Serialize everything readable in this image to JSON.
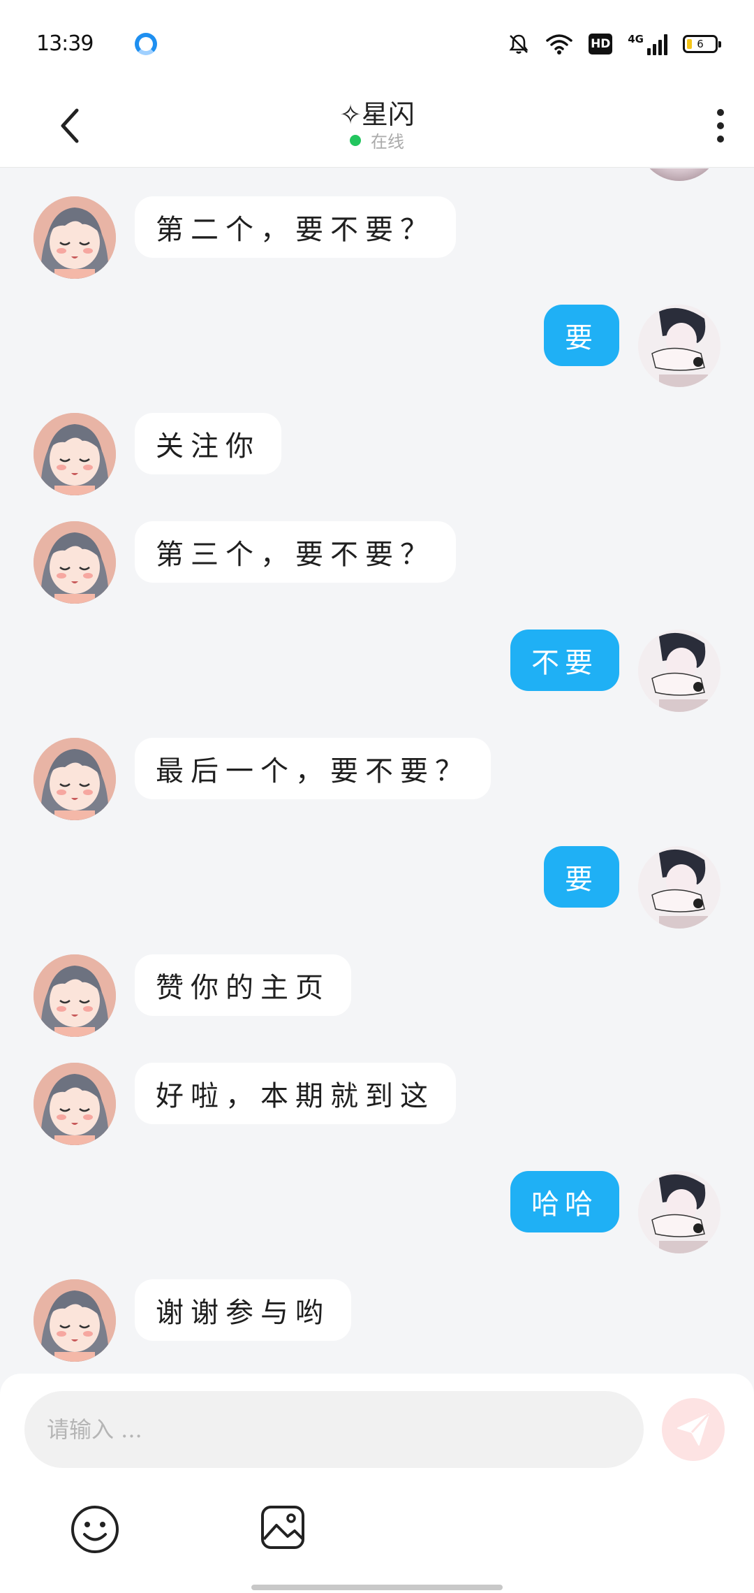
{
  "status_bar": {
    "time": "13:39",
    "network": "4G",
    "hd_label": "HD",
    "battery": "6"
  },
  "header": {
    "back_icon": "chevron-left-icon",
    "title": "✧星闪",
    "online_status": "在线",
    "online_color": "#22c55e",
    "more_icon": "more-vertical-icon"
  },
  "messages": [
    {
      "sender": "other",
      "text": "第二个，要不要？"
    },
    {
      "sender": "me",
      "text": "要"
    },
    {
      "sender": "other",
      "text": "关注你"
    },
    {
      "sender": "other",
      "text": "第三个，要不要？"
    },
    {
      "sender": "me",
      "text": "不要"
    },
    {
      "sender": "other",
      "text": "最后一个，要不要？"
    },
    {
      "sender": "me",
      "text": "要"
    },
    {
      "sender": "other",
      "text": "赞你的主页"
    },
    {
      "sender": "other",
      "text": "好啦，本期就到这"
    },
    {
      "sender": "me",
      "text": "哈哈"
    },
    {
      "sender": "other",
      "text": "谢谢参与哟"
    }
  ],
  "colors": {
    "bubble_me": "#1fb0f5",
    "bubble_other": "#ffffff",
    "background": "#f4f5f7",
    "send_button": "#fde3e3"
  },
  "input": {
    "placeholder": "请输入 ..."
  },
  "toolbar": {
    "emoji_icon": "emoji-icon",
    "image_icon": "image-icon",
    "send_icon": "send-icon"
  }
}
